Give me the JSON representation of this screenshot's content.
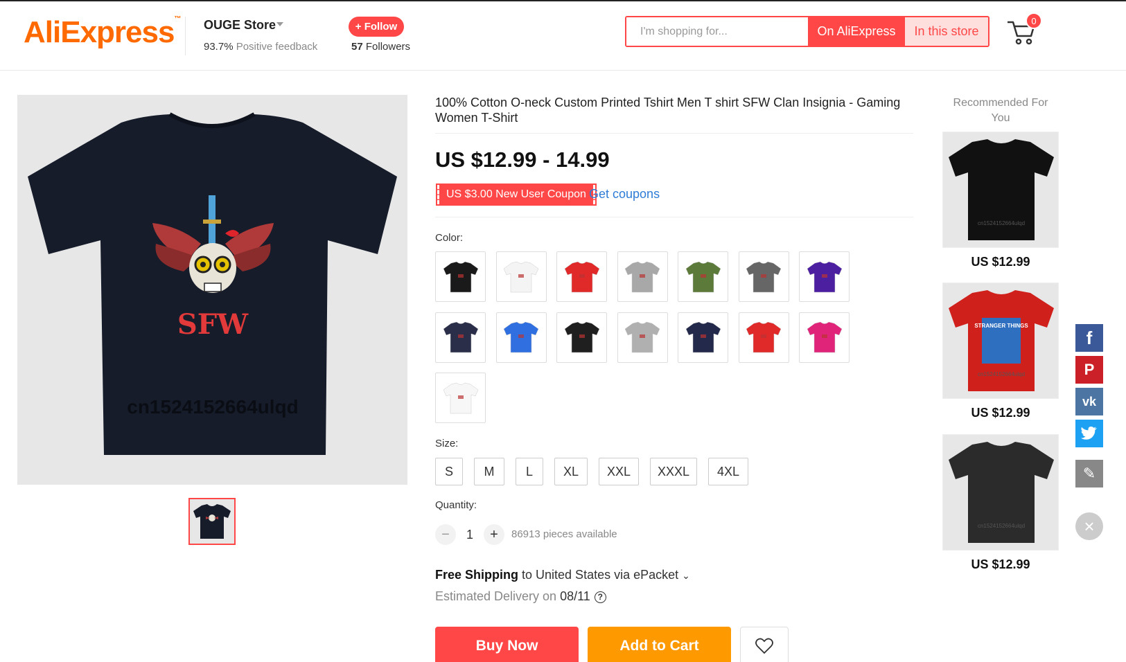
{
  "header": {
    "logo_text": "AliExpress",
    "logo_tm": "™",
    "store_name": "OUGE Store",
    "feedback_percent": "93.7%",
    "feedback_label": " Positive feedback",
    "follow_label": "+ Follow",
    "followers_count": "57",
    "followers_label": " Followers",
    "search_placeholder": "I'm shopping for...",
    "search_on_aliexpress": "On AliExpress",
    "search_in_store": "In this store",
    "cart_count": "0"
  },
  "product": {
    "title": "100% Cotton O-neck Custom Printed Tshirt Men T shirt SFW Clan Insignia - Gaming Women T-Shirt",
    "price": "US $12.99 - 14.99",
    "coupon_label": "US $3.00 New User Coupon",
    "get_coupons": "Get coupons",
    "image_text": "SFW",
    "image_watermark": "cn1524152664ulqd",
    "color_label": "Color:",
    "colors": [
      "#1a1a1a",
      "#f4f4f4",
      "#e02a2a",
      "#a8a8a8",
      "#5c7a3a",
      "#666666",
      "#4b1fa0",
      "#2a2e48",
      "#2f6fe0",
      "#1f1f1f",
      "#b0b0b0",
      "#23294a",
      "#e02a2a",
      "#e0247a",
      "#f7f7f7"
    ],
    "size_label": "Size:",
    "sizes": [
      "S",
      "M",
      "L",
      "XL",
      "XXL",
      "XXXL",
      "4XL"
    ],
    "quantity_label": "Quantity:",
    "quantity": "1",
    "qty_minus": "−",
    "qty_plus": "+",
    "available": "86913 pieces available",
    "shipping_free": "Free Shipping",
    "shipping_rest": " to United States via ePacket",
    "shipping_caret": "⌄",
    "delivery_label": "Estimated Delivery on ",
    "delivery_date": "08/11",
    "help": "?",
    "buy_now": "Buy Now",
    "add_to_cart": "Add to Cart"
  },
  "recommended": {
    "title": "Recommended For You",
    "items": [
      {
        "price": "US $12.99",
        "shirt": "#111111",
        "watermark": "cn1524152664ulqd"
      },
      {
        "price": "US $12.99",
        "shirt": "#d0201c",
        "watermark": "cn1524152664ulqd",
        "print": "STRANGER THINGS"
      },
      {
        "price": "US $12.99",
        "shirt": "#2b2b2b",
        "watermark": "cn1524152664ulqd"
      }
    ]
  },
  "social": {
    "facebook": "#3b5998",
    "pinterest": "#cb2027",
    "vk": "#4c75a3",
    "twitter": "#1da1f2",
    "edit": "#888888",
    "facebook_glyph": "f",
    "pinterest_glyph": "P",
    "vk_glyph": "vk",
    "edit_glyph": "✎",
    "close_glyph": "×"
  }
}
